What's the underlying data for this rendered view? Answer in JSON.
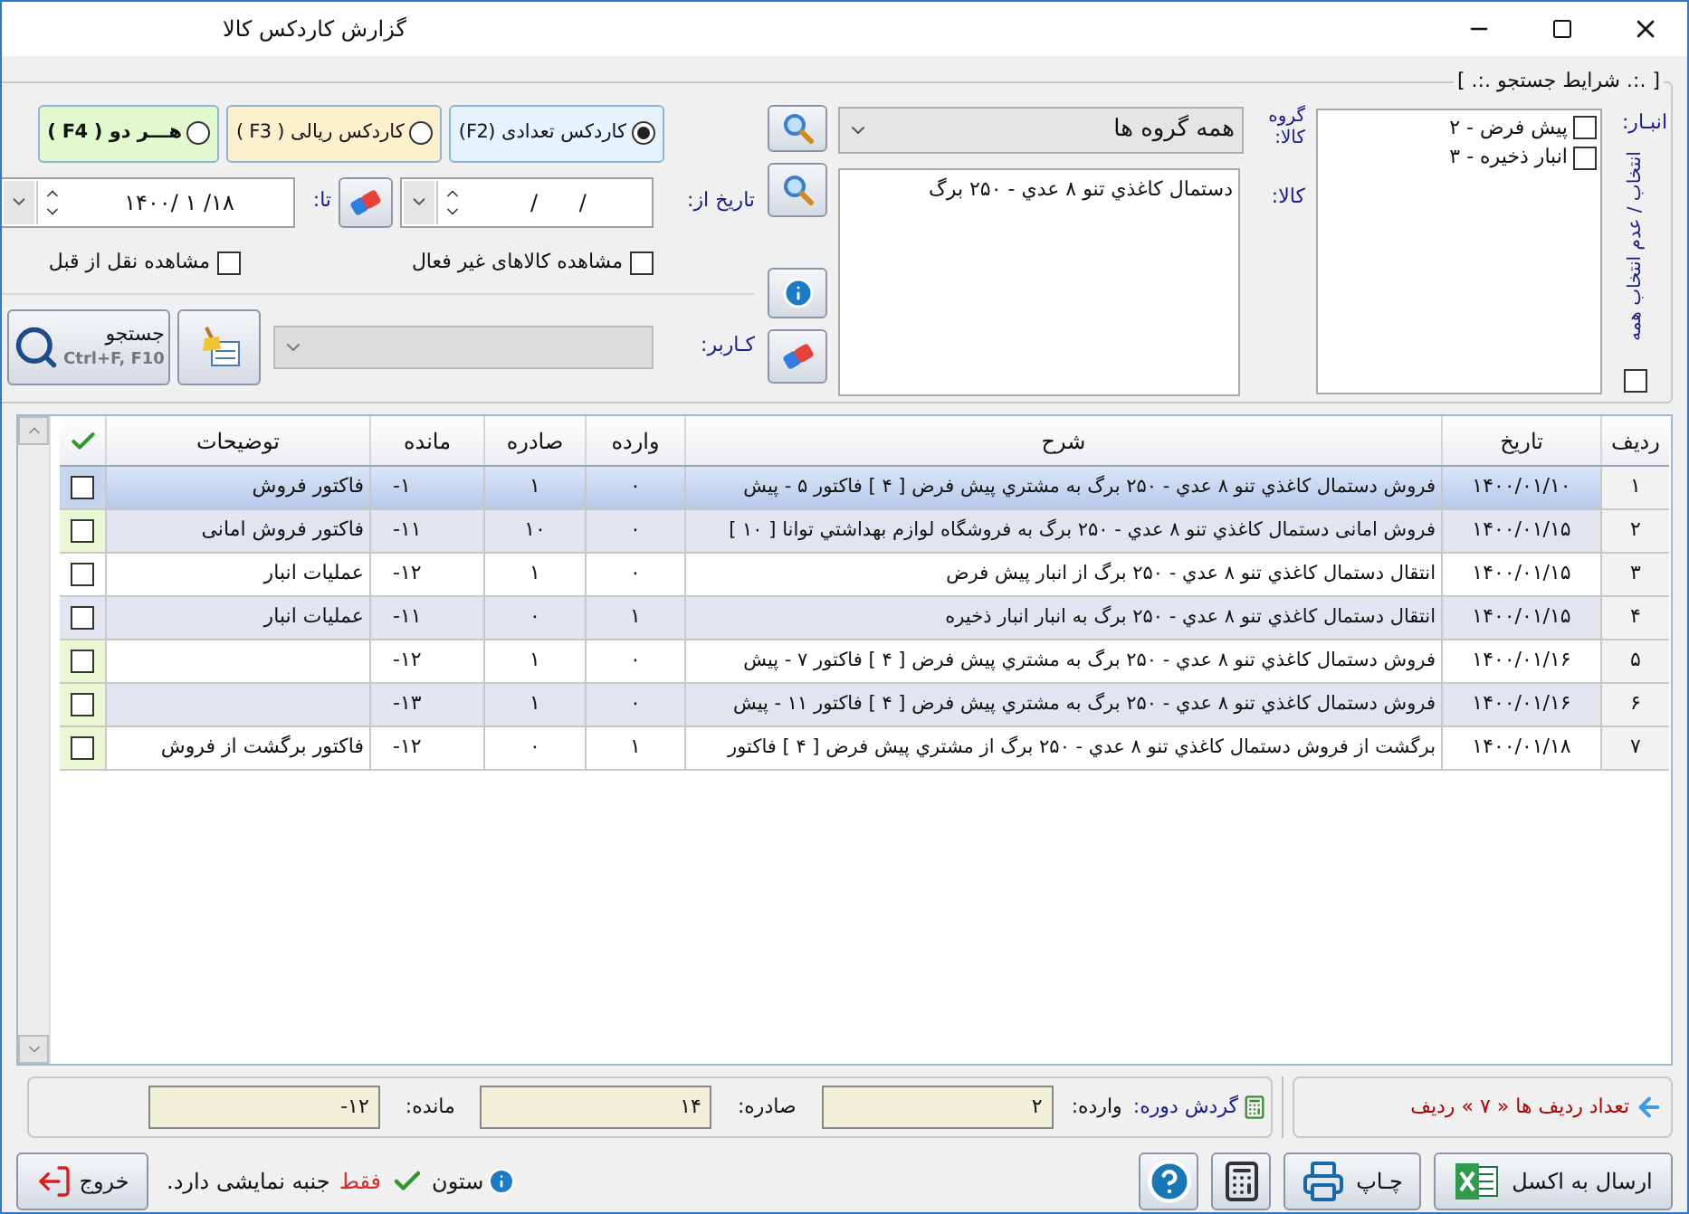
{
  "window": {
    "title": "گزارش کاردکس کالا"
  },
  "search_panel": {
    "legend": "[ .:. شرايط جستجو .:. ]",
    "warehouse": {
      "label": "انبـار:",
      "items": [
        {
          "label": "پيش فرض - ۲",
          "checked": false
        },
        {
          "label": "انبار ذخيره - ۳",
          "checked": false
        }
      ],
      "select_all": {
        "label": "انتخاب / عدم انتخاب همه",
        "checked": false
      }
    },
    "group": {
      "label": "گروه کالا:",
      "value": "همه گروه ها"
    },
    "product": {
      "label": "کالا:",
      "items": [
        "دستمال كاغذي تنو ۸ عدي - ۲۵۰ برگ"
      ]
    },
    "modes": [
      {
        "label": "کاردکس تعدادی (F2)",
        "selected": true,
        "color": "#e5f3fe"
      },
      {
        "label": "کاردکس ریالی ( F3 )",
        "selected": false,
        "color": "#fdf1cd"
      },
      {
        "label": "هـــر دو ( F4 )",
        "selected": false,
        "color": "#e2f9d0"
      }
    ],
    "date_from": {
      "label": "تاریخ از:",
      "value": "/      /"
    },
    "date_to": {
      "label": "تا:",
      "value": "۱۴۰۰/ ۱ /۱۸"
    },
    "options": [
      {
        "label": "مشاهده کالاهای غیر فعال",
        "checked": false
      },
      {
        "label": "مشاهده نقل از قبل",
        "checked": false
      }
    ],
    "user": {
      "label": "کـاربر:",
      "disabled": true
    },
    "search_button": {
      "label": "جستجو",
      "shortcut": "Ctrl+F, F10"
    }
  },
  "table": {
    "columns": [
      "ردیف",
      "تاریخ",
      "شرح",
      "وارده",
      "صادره",
      "مانده",
      "توضیحات"
    ],
    "rows": [
      {
        "cells": [
          "۱",
          "۱۴۰۰/۰۱/۱۰",
          "فروش دستمال كاغذي تنو ۸ عدي - ۲۵۰ برگ  به  مشتري پيش فرض [ ۴ ] فاكتور ۵ - پيش",
          "۰",
          "۱",
          "-۱",
          "فاكتور فروش"
        ],
        "selected": true,
        "checked": false,
        "color": "#c6d6ef"
      },
      {
        "cells": [
          "۲",
          "۱۴۰۰/۰۱/۱۵",
          "فروش امانى دستمال كاغذي تنو ۸ عدي - ۲۵۰ برگ  به  فروشگاه لوازم بهداشتي توانا [ ۱۰ ]",
          "۰",
          "۱۰",
          "-۱۱",
          "فاكتور فروش امانى"
        ],
        "selected": false,
        "checked": false,
        "color": "#e9f8d2"
      },
      {
        "cells": [
          "۳",
          "۱۴۰۰/۰۱/۱۵",
          "انتقال دستمال كاغذي تنو ۸ عدي - ۲۵۰ برگ  از انبار پيش فرض",
          "۰",
          "۱",
          "-۱۲",
          "عمليات انبار"
        ],
        "selected": false,
        "checked": false,
        "color": "#ffffff"
      },
      {
        "cells": [
          "۴",
          "۱۴۰۰/۰۱/۱۵",
          "انتقال دستمال كاغذي تنو ۸ عدي - ۲۵۰ برگ  به انبار  انبار ذخيره",
          "۱",
          "۰",
          "-۱۱",
          "عمليات انبار"
        ],
        "selected": false,
        "checked": false,
        "color": "#e2e5f0"
      },
      {
        "cells": [
          "۵",
          "۱۴۰۰/۰۱/۱۶",
          "فروش دستمال كاغذي تنو ۸ عدي - ۲۵۰ برگ  به  مشتري پيش فرض [ ۴ ] فاكتور ۷ - پيش",
          "۰",
          "۱",
          "-۱۲",
          ""
        ],
        "selected": false,
        "checked": false,
        "color": "#e9f8d2"
      },
      {
        "cells": [
          "۶",
          "۱۴۰۰/۰۱/۱۶",
          "فروش دستمال كاغذي تنو ۸ عدي - ۲۵۰ برگ  به  مشتري پيش فرض [ ۴ ] فاكتور ۱۱ - پيش",
          "۰",
          "۱",
          "-۱۳",
          ""
        ],
        "selected": false,
        "checked": false,
        "color": "#e9f8d2"
      },
      {
        "cells": [
          "۷",
          "۱۴۰۰/۰۱/۱۸",
          "برگشت از فروش دستمال كاغذي تنو ۸ عدي - ۲۵۰ برگ  از  مشتري پيش فرض [ ۴ ] فاكتور",
          "۱",
          "۰",
          "-۱۲",
          "فاكتور برگشت از فروش"
        ],
        "selected": false,
        "checked": false,
        "color": "#e9f8d2"
      }
    ]
  },
  "totals": {
    "title": "گردش دوره:",
    "fields": [
      {
        "label": "وارده:",
        "value": "۲"
      },
      {
        "label": "صادره:",
        "value": "۱۴"
      },
      {
        "label": "مانده:",
        "value": "-۱۲"
      }
    ]
  },
  "row_count": "تعداد ردیف ها « ۷ » ردیف",
  "buttons": [
    {
      "kind": "excel",
      "label": "ارسال به اکسل"
    },
    {
      "kind": "print",
      "label": "چـاپ"
    },
    {
      "kind": "calculator"
    },
    {
      "kind": "help"
    }
  ],
  "note": [
    "ستون",
    "فقط",
    "جنبه نمایشی دارد."
  ],
  "exit_button": "خروج"
}
